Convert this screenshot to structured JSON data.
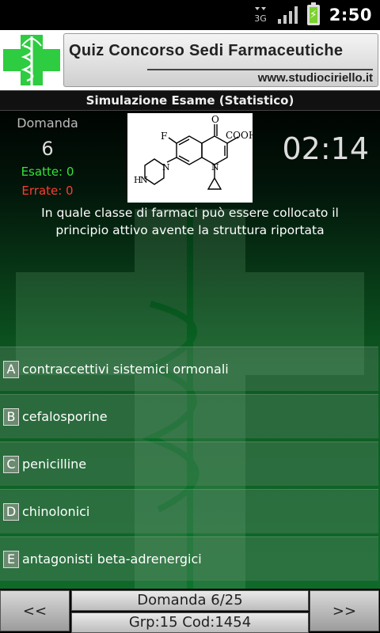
{
  "status_bar": {
    "network": "3G",
    "time": "2:50"
  },
  "header": {
    "title": "Quiz Concorso Sedi Farmaceutiche",
    "website": "www.studiociriello.it"
  },
  "subtitle": "Simulazione Esame (Statistico)",
  "question_panel": {
    "label": "Domanda",
    "number": "6",
    "correct": "Esatte: 0",
    "wrong": "Errate: 0",
    "timer": "02:14",
    "text": "In quale classe di farmaci può essere collocato il principio attivo avente la struttura riportata",
    "structure_labels": {
      "o": "O",
      "cooh": "COOH",
      "f": "F",
      "n": "N",
      "h": "H",
      "n2": "N",
      "n3": "N"
    }
  },
  "answers": [
    {
      "letter": "A",
      "text": "contraccettivi sistemici ormonali"
    },
    {
      "letter": "B",
      "text": "cefalosporine"
    },
    {
      "letter": "C",
      "text": "penicilline"
    },
    {
      "letter": "D",
      "text": "chinolonici"
    },
    {
      "letter": "E",
      "text": "antagonisti beta-adrenergici"
    }
  ],
  "footer": {
    "prev_label": "<<",
    "next_label": ">>",
    "progress": "Domanda 6/25",
    "codes": "Grp:15  Cod:1454"
  },
  "colors": {
    "correct": "#37e23a",
    "wrong": "#ff3b30",
    "logo_green": "#2ecc40"
  }
}
